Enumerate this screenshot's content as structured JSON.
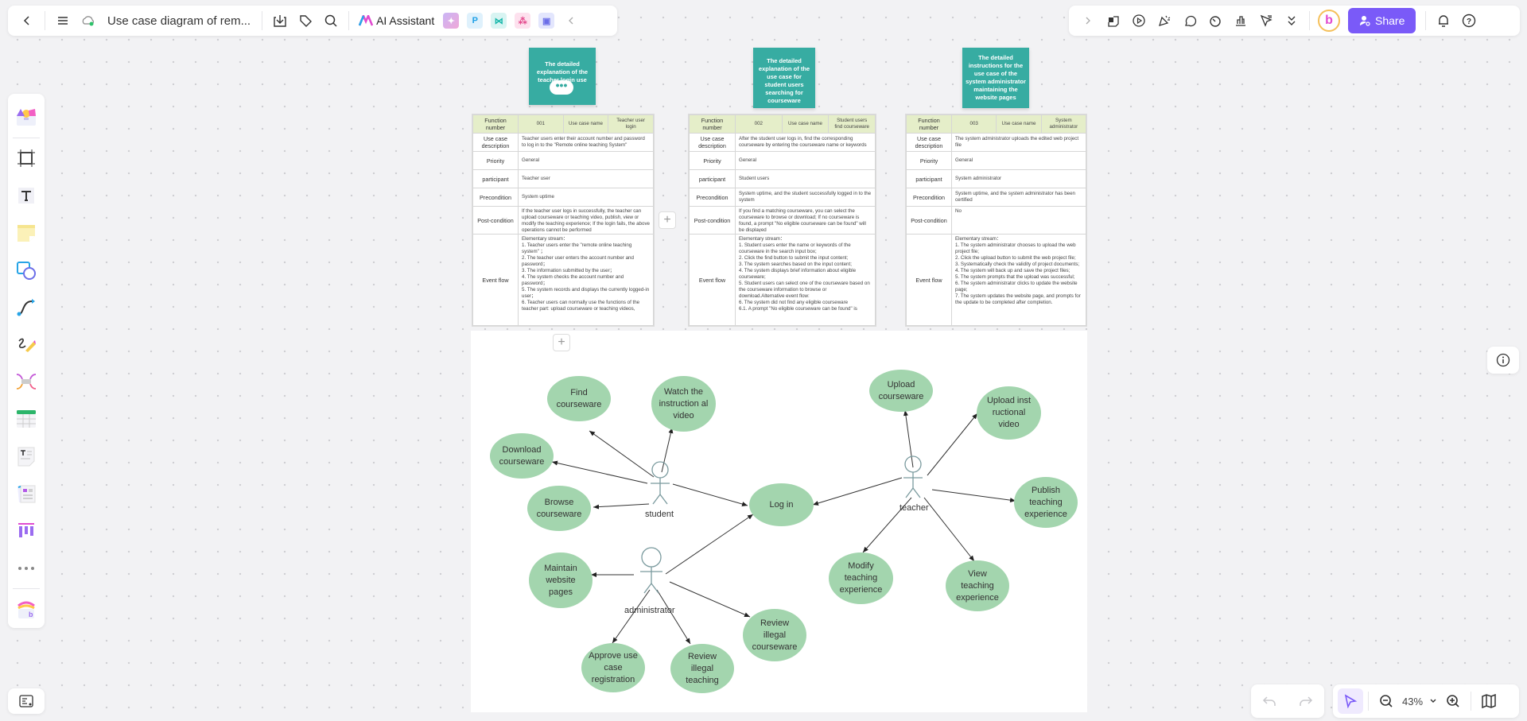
{
  "header": {
    "title": "Use case diagram of rem...",
    "ai_assistant": "AI Assistant",
    "share": "Share",
    "zoom_level": "43%"
  },
  "colors": {
    "accent": "#7a5af8",
    "note": "#37aca2",
    "usecase": "#a3d5ae",
    "table_header": "#e5eec9"
  },
  "icons": {
    "left_toolbar": [
      "back-icon",
      "menu-icon",
      "cloud-sync-icon",
      "download-icon",
      "tag-icon",
      "search-icon"
    ],
    "right_toolbar": [
      "expand-icon",
      "template-icon",
      "present-icon",
      "celebrate-icon",
      "comment-icon",
      "timer-icon",
      "chart-icon",
      "cursor-filter-icon",
      "more-icon",
      "notification-icon",
      "help-icon"
    ],
    "sidebar": [
      "templates-icon",
      "frame-icon",
      "text-icon",
      "sticky-note-icon",
      "shapes-icon",
      "connector-icon",
      "pen-icon",
      "mindmap-icon",
      "table-icon",
      "document-icon",
      "slides-icon",
      "more-icon",
      "app-icon"
    ]
  },
  "notes": [
    {
      "text": "The detailed explanation of the teacher login use case"
    },
    {
      "text": "The detailed explanation of the use case for student users searching for courseware"
    },
    {
      "text": "The detailed instructions for the use case of the system administrator maintaining the website pages"
    }
  ],
  "tables": [
    {
      "function_number_label": "Function number",
      "function_number": "001",
      "use_case_name_label": "Use case name",
      "use_case_name": "Teacher user login",
      "rows": [
        {
          "label": "Use case description",
          "value": "Teacher users enter their account number and password to log in to the \"Remote online teaching System\""
        },
        {
          "label": "Priority",
          "value": "General"
        },
        {
          "label": "participant",
          "value": "Teacher user"
        },
        {
          "label": "Precondition",
          "value": "System uptime"
        },
        {
          "label": "Post-condition",
          "value": "If the teacher user logs in successfully, the teacher can upload courseware or teaching video, publish, view or modify the teaching experience; If the login fails, the above operations cannot be performed"
        },
        {
          "label": "Event flow",
          "value": "Elementary stream：\n1. Teacher users enter the \"remote online teaching system\" ；\n2. The teacher user enters the account number and password；\n3. The information submitted by the user；\n4. The system checks the account number and password；\n5. The system records and displays the currently logged-in user；\n6. Teacher users can normally use the functions of the teacher part: upload courseware or teaching videos,"
        }
      ]
    },
    {
      "function_number_label": "Function number",
      "function_number": "002",
      "use_case_name_label": "Use case name",
      "use_case_name": "Student users find courseware",
      "rows": [
        {
          "label": "Use case description",
          "value": "After the student user logs in, find the corresponding courseware by entering the courseware name or keywords"
        },
        {
          "label": "Priority",
          "value": "General"
        },
        {
          "label": "participant",
          "value": "Student users"
        },
        {
          "label": "Precondition",
          "value": "System uptime, and the student successfully logged in to the system"
        },
        {
          "label": "Post-condition",
          "value": "If you find a matching courseware, you can select the courseware to browse or download; If no courseware is found, a prompt \"No eligible courseware can be found\" will be displayed"
        },
        {
          "label": "Event flow",
          "value": "Elementary stream：\n1. Student users enter the name or keywords of the courseware in the search input box;\n2. Click the find button to submit the input content;\n3. The system searches based on the input content;\n4. The system displays brief information about eligible courseware;\n5. Student users can select one of the courseware based on the courseware information to browse or download.Alternative event flow:\n6. The system did not find any eligible courseware\n  6.1. A prompt \"No eligible courseware can be found\" is"
        }
      ]
    },
    {
      "function_number_label": "Function number",
      "function_number": "003",
      "use_case_name_label": "Use case name",
      "use_case_name": "System administrator",
      "rows": [
        {
          "label": "Use case description",
          "value": "The system administrator uploads the edited web project file"
        },
        {
          "label": "Priority",
          "value": "General"
        },
        {
          "label": "participant",
          "value": "System administrator"
        },
        {
          "label": "Precondition",
          "value": "System uptime, and the system administrator has been certified"
        },
        {
          "label": "Post-condition",
          "value": "No"
        },
        {
          "label": "Event flow",
          "value": "Elementary stream：\n1. The system administrator chooses to upload the web project file;\n2. Click the upload button to submit the web project file;\n3. Systematically check the validity of project documents;\n4. The system will back up and save the project files;\n5. The system prompts that the upload was successful;\n6. The system administrator clicks to update the website page;\n7. The system updates the website page, and prompts for the update to be completed after completion."
        }
      ]
    }
  ],
  "diagram": {
    "actors": {
      "student": "student",
      "teacher": "teacher",
      "administrator": "administrator"
    },
    "use_cases": {
      "find": "Find courseware",
      "watch": "Watch the instruction al video",
      "download": "Download courseware",
      "browse": "Browse courseware",
      "login": "Log in",
      "upload_course": "Upload courseware",
      "upload_video": "Upload inst ructional video",
      "publish": "Publish teaching experience",
      "modify": "Modify teaching experience",
      "view": "View teaching experience",
      "maintain": "Maintain website pages",
      "approve": "Approve use case registration",
      "review_teaching": "Review illegal teaching",
      "review_course": "Review illegal courseware"
    }
  }
}
